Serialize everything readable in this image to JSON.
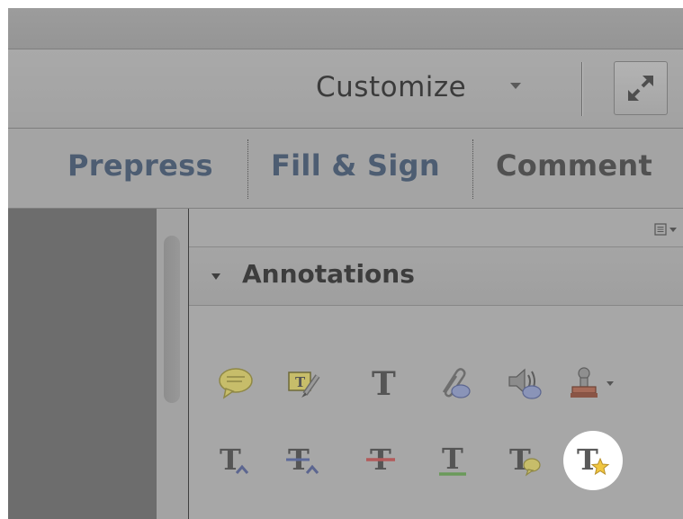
{
  "toolbar": {
    "customize_label": "Customize",
    "customize_dropdown_icon": "chevron-down-icon",
    "fullscreen_icon": "expand-arrows-icon"
  },
  "tabs": [
    {
      "label": "Prepress"
    },
    {
      "label": "Fill & Sign"
    },
    {
      "label": "Comment"
    }
  ],
  "panel": {
    "options_icon": "panel-options-menu-icon",
    "section_title": "Annotations"
  },
  "tools": {
    "row1": [
      "sticky-note-icon",
      "highlight-text-icon",
      "add-text-icon",
      "attach-file-icon",
      "record-audio-icon",
      "stamp-icon"
    ],
    "row2": [
      "insert-text-icon",
      "replace-text-icon",
      "strikethrough-icon",
      "underline-icon",
      "text-comment-icon",
      "text-star-icon"
    ]
  },
  "colors": {
    "tab_active_text": "#4d5d72",
    "tab_inactive_text": "#515151",
    "highlight_circle": "#ffffff"
  }
}
